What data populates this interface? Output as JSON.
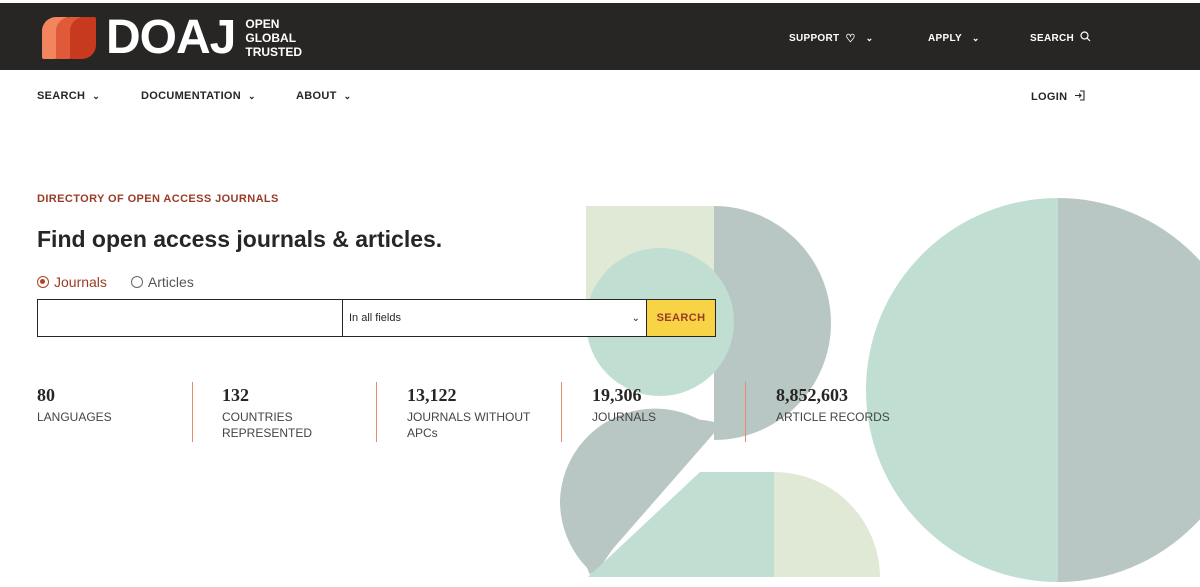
{
  "brand": {
    "name": "DOAJ",
    "tagline": [
      "OPEN",
      "GLOBAL",
      "TRUSTED"
    ]
  },
  "topnav": {
    "support": "SUPPORT",
    "apply": "APPLY",
    "search": "SEARCH"
  },
  "subnav": {
    "search": "SEARCH",
    "documentation": "DOCUMENTATION",
    "about": "ABOUT",
    "login": "LOGIN"
  },
  "hero": {
    "eyebrow": "DIRECTORY OF OPEN ACCESS JOURNALS",
    "headline": "Find open access journals & articles.",
    "radio_journals": "Journals",
    "radio_articles": "Articles",
    "selected": "Journals",
    "search_value": "",
    "search_placeholder": "",
    "field_select": "In all fields",
    "search_button": "SEARCH"
  },
  "stats": [
    {
      "value": "80",
      "caption": "LANGUAGES"
    },
    {
      "value": "132",
      "caption": "COUNTRIES REPRESENTED"
    },
    {
      "value": "13,122",
      "caption": "JOURNALS WITHOUT APCs"
    },
    {
      "value": "19,306",
      "caption": "JOURNALS"
    },
    {
      "value": "8,852,603",
      "caption": "ARTICLE RECORDS"
    }
  ],
  "colors": {
    "header_bg": "#282624",
    "accent": "#9a3b26",
    "button_yellow": "#f7d345",
    "divider": "#e58a6f",
    "shape_grey": "#b9c7c4",
    "shape_mint": "#c0ded1",
    "shape_pale": "#dfe9d5"
  },
  "icons": {
    "support": "heart-icon",
    "search": "search-icon",
    "login": "login-icon",
    "chevron": "chevron-down-icon"
  }
}
